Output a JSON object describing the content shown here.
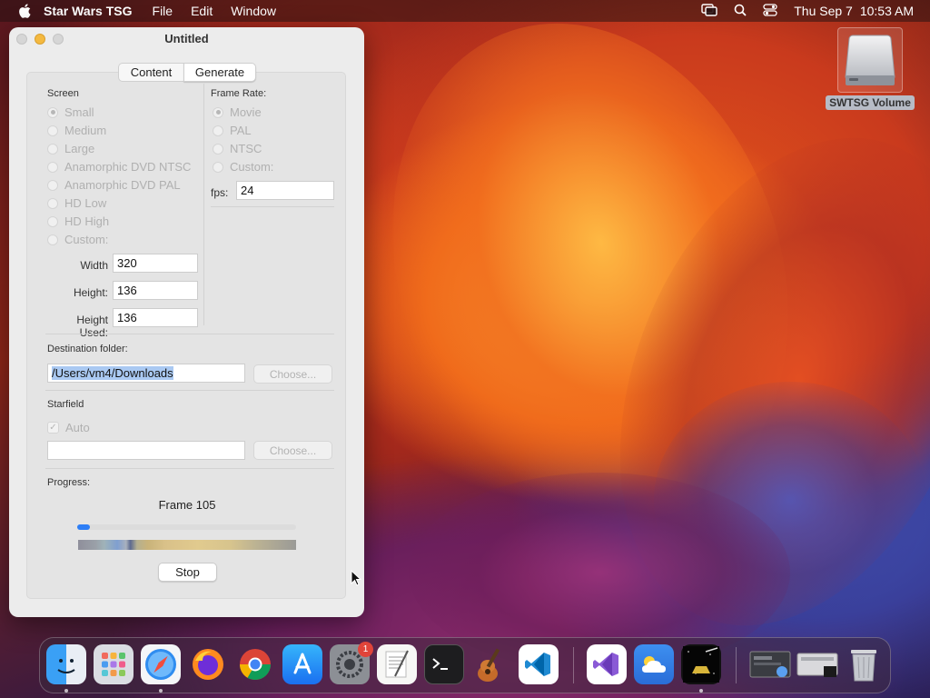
{
  "menubar": {
    "app_name": "Star Wars TSG",
    "menus": [
      "File",
      "Edit",
      "Window"
    ],
    "clock_day": "Thu Sep 7",
    "clock_time": "10:53 AM"
  },
  "desktop": {
    "volume_label": "SWTSG Volume"
  },
  "window": {
    "title": "Untitled",
    "tabs": [
      {
        "label": "Content",
        "selected": false
      },
      {
        "label": "Generate",
        "selected": true
      }
    ],
    "screen": {
      "label": "Screen",
      "options": [
        "Small",
        "Medium",
        "Large",
        "Anamorphic DVD NTSC",
        "Anamorphic DVD PAL",
        "HD Low",
        "HD High",
        "Custom:"
      ],
      "selected": "Small",
      "width_label": "Width",
      "width_value": "320",
      "height_label": "Height:",
      "height_value": "136",
      "height_used_label": "Height Used:",
      "height_used_value": "136"
    },
    "frame_rate": {
      "label": "Frame Rate:",
      "options": [
        "Movie",
        "PAL",
        "NTSC",
        "Custom:"
      ],
      "selected": "Movie",
      "fps_label": "fps:",
      "fps_value": "24"
    },
    "destination": {
      "label": "Destination folder:",
      "path": "/Users/vm4/Downloads",
      "choose_label": "Choose..."
    },
    "starfield": {
      "label": "Starfield",
      "auto_label": "Auto",
      "auto_checked": true,
      "path": "",
      "choose_label": "Choose..."
    },
    "progress": {
      "label": "Progress:",
      "status": "Frame 105",
      "fraction": 0.06,
      "stop_label": "Stop"
    }
  },
  "dock": {
    "apps": [
      "finder-icon",
      "launchpad-icon",
      "safari-icon",
      "firefox-icon",
      "chrome-icon",
      "app-store-icon",
      "system-settings-icon",
      "textedit-icon",
      "terminal-icon",
      "garageband-icon",
      "vscode-icon",
      "visual-studio-icon",
      "weather-icon",
      "star-wars-tsg-icon",
      "window-preview-1-icon",
      "window-preview-2-icon",
      "trash-icon"
    ],
    "settings_badge": "1"
  },
  "colors": {
    "accent": "#2d7ef6",
    "selection": "#aac9f2"
  }
}
